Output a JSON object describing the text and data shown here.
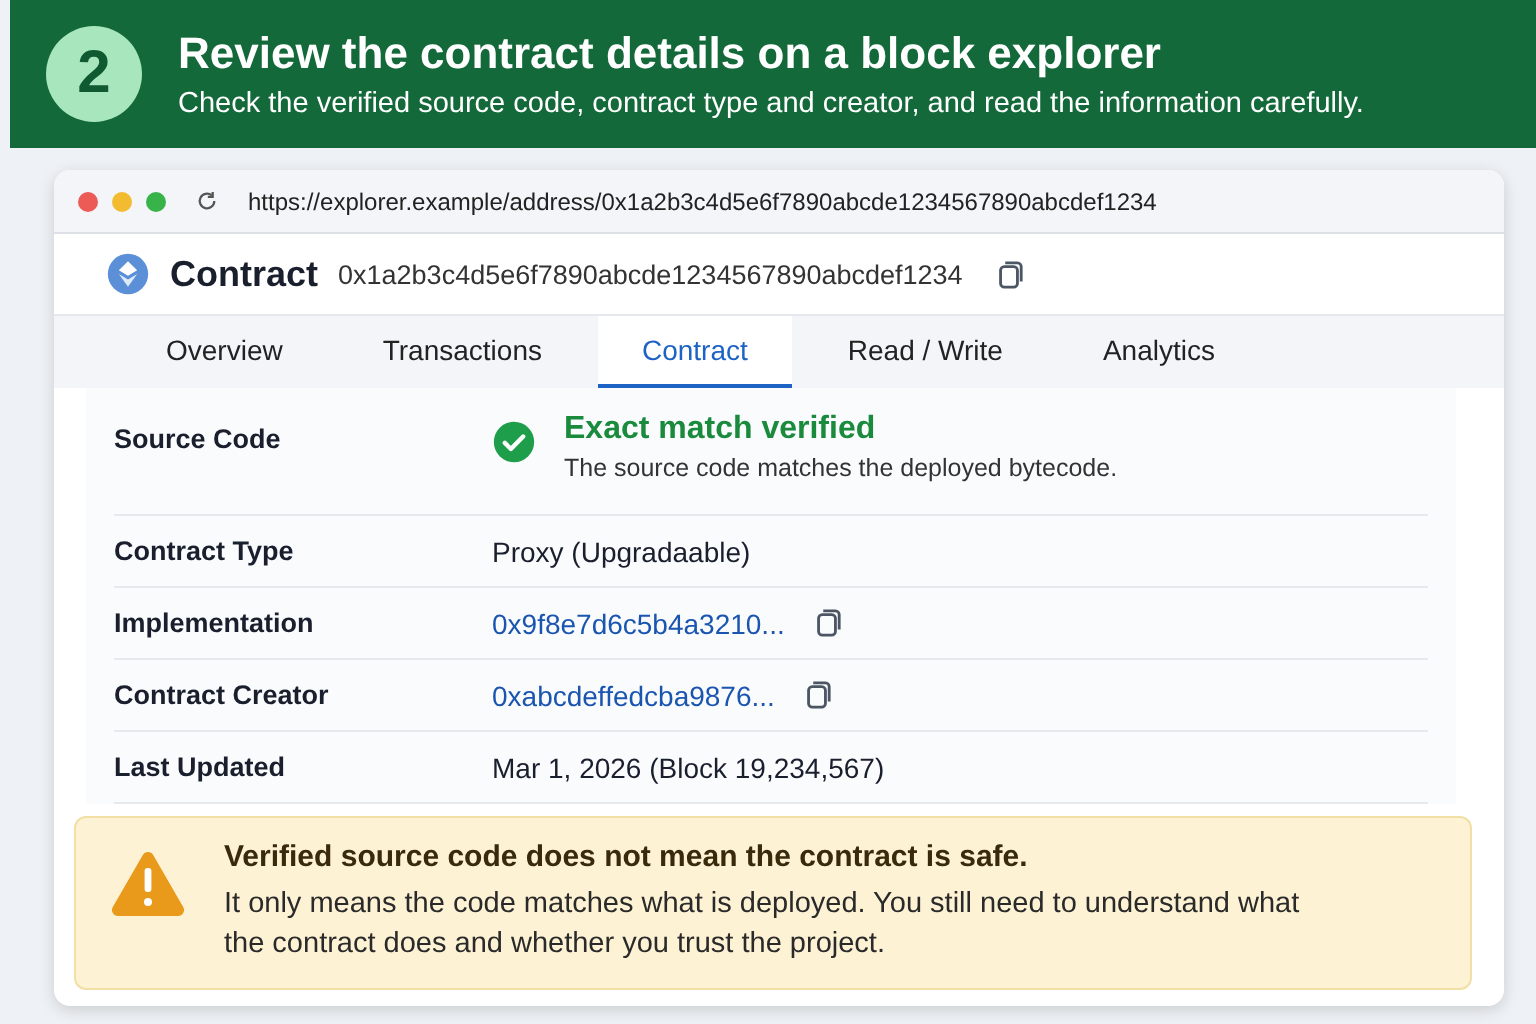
{
  "step": {
    "number": "2",
    "title": "Review the contract details on a block explorer",
    "subtitle": "Check the verified source code, contract type and creator, and read the information carefully."
  },
  "browser": {
    "url": "https://explorer.example/address/0x1a2b3c4d5e6f7890abcde1234567890abcdef1234"
  },
  "contract": {
    "label": "Contract",
    "address": "0x1a2b3c4d5e6f7890abcde1234567890abcdef1234"
  },
  "tabs": [
    {
      "label": "Overview",
      "selected": false
    },
    {
      "label": "Transactions",
      "selected": false
    },
    {
      "label": "Contract",
      "selected": true
    },
    {
      "label": "Read / Write",
      "selected": false
    },
    {
      "label": "Analytics",
      "selected": false
    }
  ],
  "details": [
    {
      "kind": "verified",
      "label": "Source Code",
      "value": "Exact match verified",
      "note": "The source code matches the deployed bytecode."
    },
    {
      "kind": "text",
      "label": "Contract Type",
      "value": "Proxy (Upgradaable)"
    },
    {
      "kind": "link",
      "label": "Implementation",
      "value": "0x9f8e7d6c5b4a3210..."
    },
    {
      "kind": "link",
      "label": "Contract Creator",
      "value": "0xabcdeffedcba9876..."
    },
    {
      "kind": "text",
      "label": "Last Updated",
      "value": "Mar 1, 2026 (Block 19,234,567)"
    }
  ],
  "warning": {
    "title": "Verified source code does not mean the contract is safe.",
    "text": "It only means the code matches what is deployed. You still need to understand what the contract does and whether you trust the project."
  }
}
